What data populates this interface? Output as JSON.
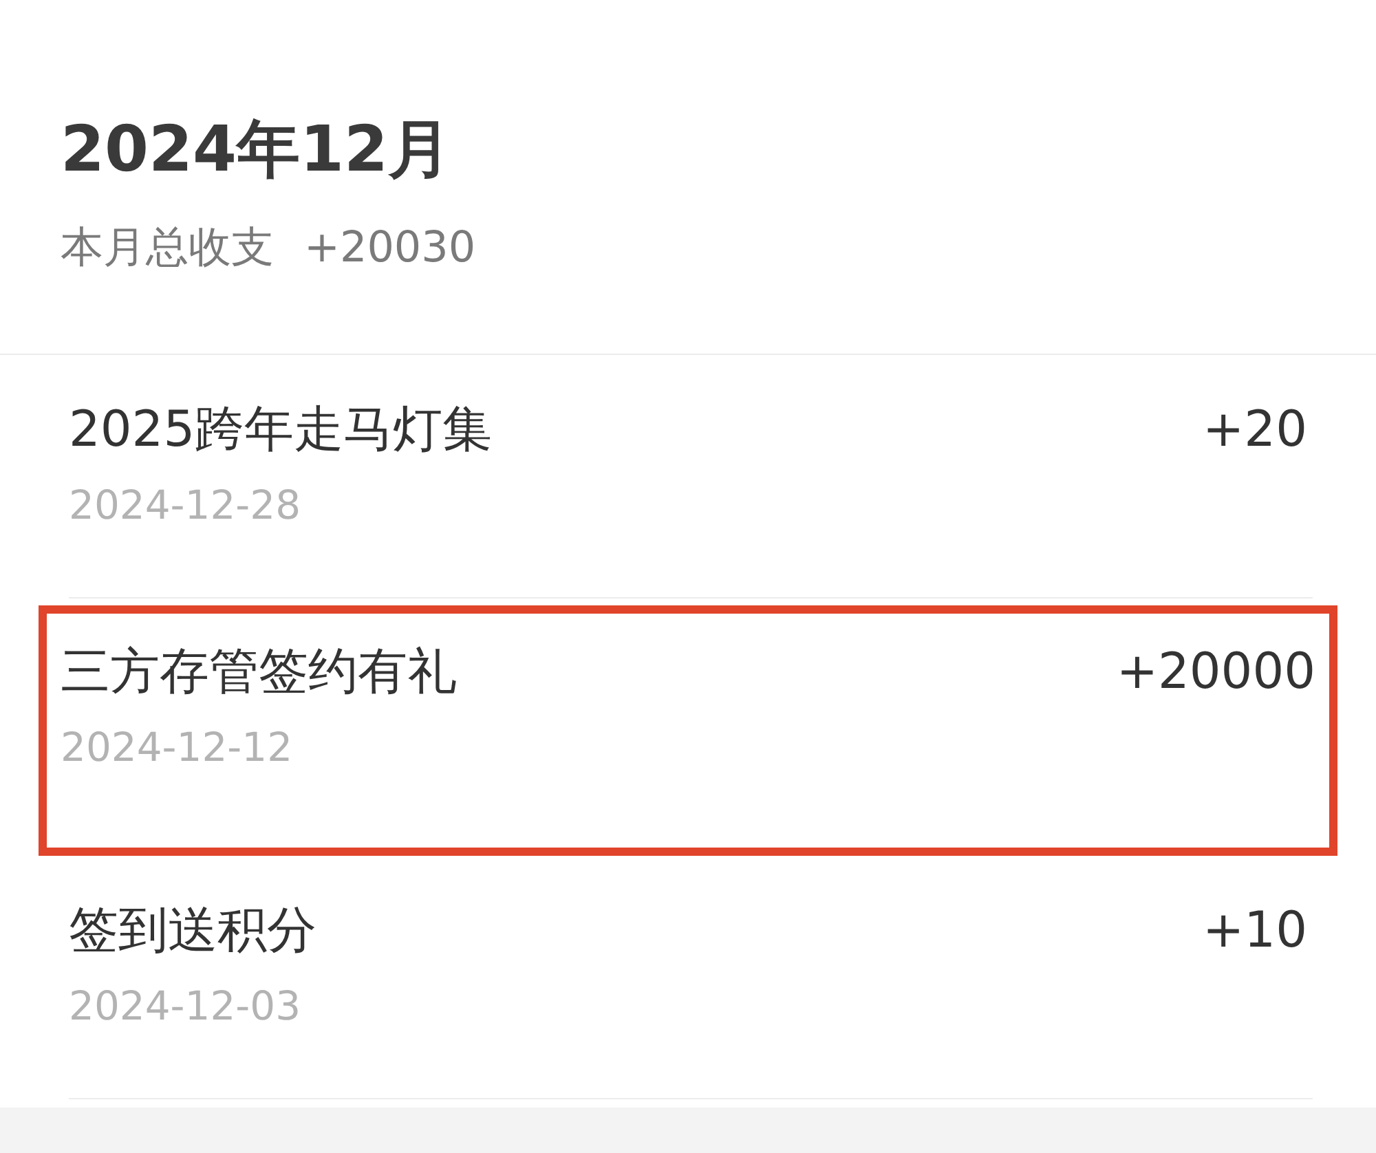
{
  "header": {
    "title": "2024年12月",
    "summary_label": "本月总收支",
    "summary_value": "+20030"
  },
  "records": [
    {
      "title": "2025跨年走马灯集",
      "date": "2024-12-28",
      "amount": "+20",
      "highlighted": false
    },
    {
      "title": "三方存管签约有礼",
      "date": "2024-12-12",
      "amount": "+20000",
      "highlighted": true
    },
    {
      "title": "签到送积分",
      "date": "2024-12-03",
      "amount": "+10",
      "highlighted": false
    }
  ]
}
